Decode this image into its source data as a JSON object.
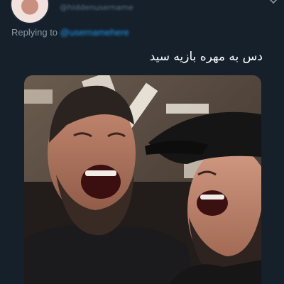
{
  "author": {
    "avatar_icon": "avatar-image",
    "handle": "@hiddenusername"
  },
  "reply": {
    "prefix": "Replying to",
    "handle": "@usernamehere"
  },
  "tweet": {
    "text": "دس به مهره بازیه سید"
  },
  "media": {
    "type": "photo",
    "description_icon": "photo-two-men-laughing"
  },
  "colors": {
    "background": "#15202b",
    "link": "#1d9bf0",
    "secondary_text": "#8899a6",
    "primary_text": "#ffffff"
  }
}
